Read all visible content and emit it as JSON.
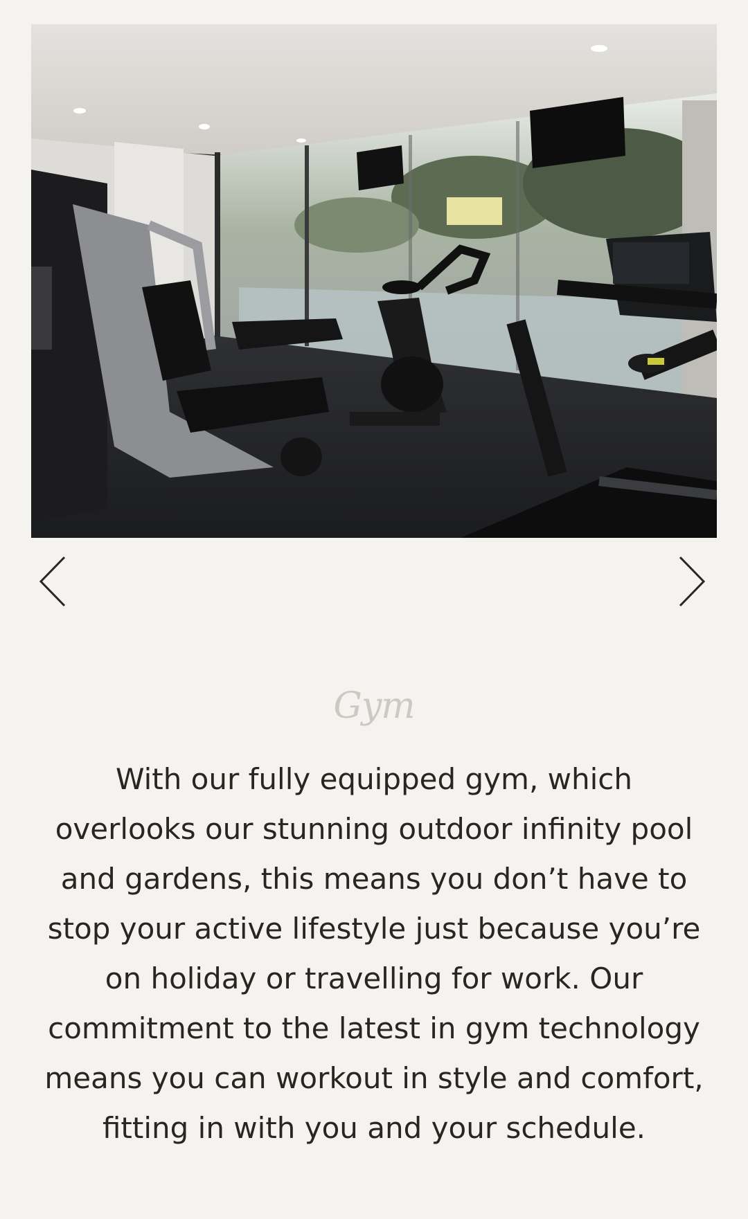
{
  "slider": {
    "image_alt": "Gym with exercise equipment overlooking pool and gardens",
    "prev_icon": "chevron-left-icon",
    "next_icon": "chevron-right-icon"
  },
  "section": {
    "title": "Gym",
    "body": "With our fully equipped gym, which overlooks our stunning outdoor infinity pool and gardens, this means you don’t have to stop your active lifestyle just because you’re on holiday or travelling for work. Our commitment to the latest in gym technology means you can workout in style and comfort, fitting in with you and your schedule."
  },
  "colors": {
    "background": "#f5f3ef",
    "title": "#cfc8c2",
    "body_text": "#2b2521",
    "arrow": "#2b2521"
  }
}
